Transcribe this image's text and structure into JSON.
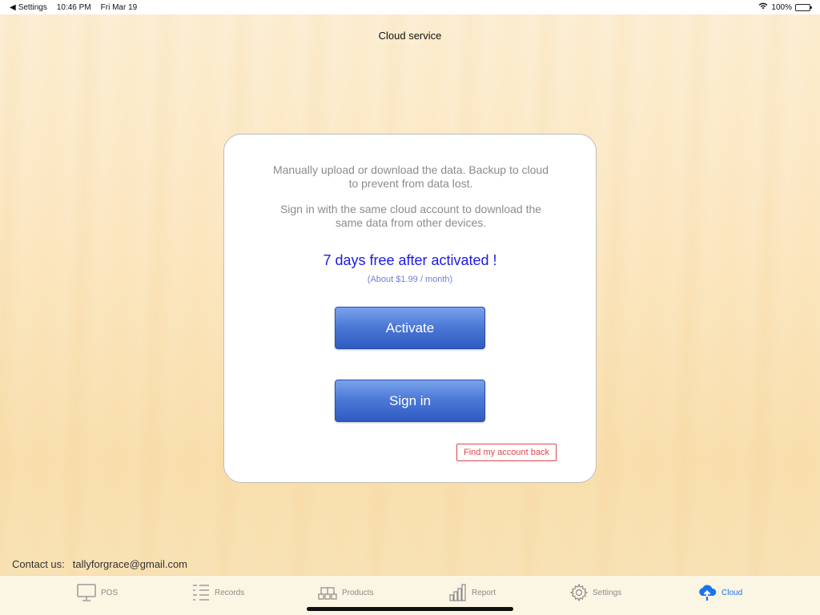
{
  "status_bar": {
    "back_label": "Settings",
    "time": "10:46 PM",
    "date": "Fri Mar 19",
    "battery": "100%"
  },
  "page": {
    "title": "Cloud service"
  },
  "card": {
    "desc1": "Manually upload or download the data. Backup to cloud to prevent from data lost.",
    "desc2": "Sign in with the same cloud account to download the same data from other devices.",
    "promo": "7 days free after activated !",
    "price": "(About $1.99 / month)",
    "activate_label": "Activate",
    "signin_label": "Sign in",
    "find_account_label": "Find my account back"
  },
  "contact": {
    "label": "Contact us:",
    "email": "tallyforgrace@gmail.com"
  },
  "tabs": [
    {
      "label": "POS",
      "icon": "monitor-icon"
    },
    {
      "label": "Records",
      "icon": "list-icon"
    },
    {
      "label": "Products",
      "icon": "products-icon"
    },
    {
      "label": "Report",
      "icon": "bar-chart-icon"
    },
    {
      "label": "Settings",
      "icon": "gear-icon"
    },
    {
      "label": "Cloud",
      "icon": "cloud-upload-icon",
      "active": true
    }
  ],
  "colors": {
    "accent_blue": "#1a73e8",
    "promo_blue": "#1a1ae6",
    "button_blue": "#3d66c8",
    "danger_red": "#e0444a"
  }
}
